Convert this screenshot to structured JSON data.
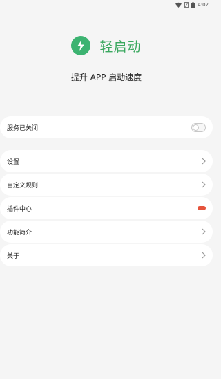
{
  "status_bar": {
    "time": "4:02",
    "icons": [
      "wifi-icon",
      "sim-icon",
      "battery-icon"
    ]
  },
  "header": {
    "app_name": "轻启动",
    "logo_icon": "lightning-icon",
    "slogan": "提升 APP 启动速度"
  },
  "service": {
    "label": "服务已关闭",
    "enabled": false
  },
  "menu": {
    "items": [
      {
        "label": "设置",
        "icon": "chevron-right-icon"
      },
      {
        "label": "自定义规则",
        "icon": "chevron-right-icon"
      },
      {
        "label": "插件中心",
        "badge": "new-badge"
      },
      {
        "label": "功能简介",
        "icon": "chevron-right-icon"
      },
      {
        "label": "关于",
        "icon": "chevron-right-icon"
      }
    ]
  },
  "colors": {
    "accent": "#3cb371",
    "badge": "#e5533c",
    "background": "#f5f5f5"
  }
}
